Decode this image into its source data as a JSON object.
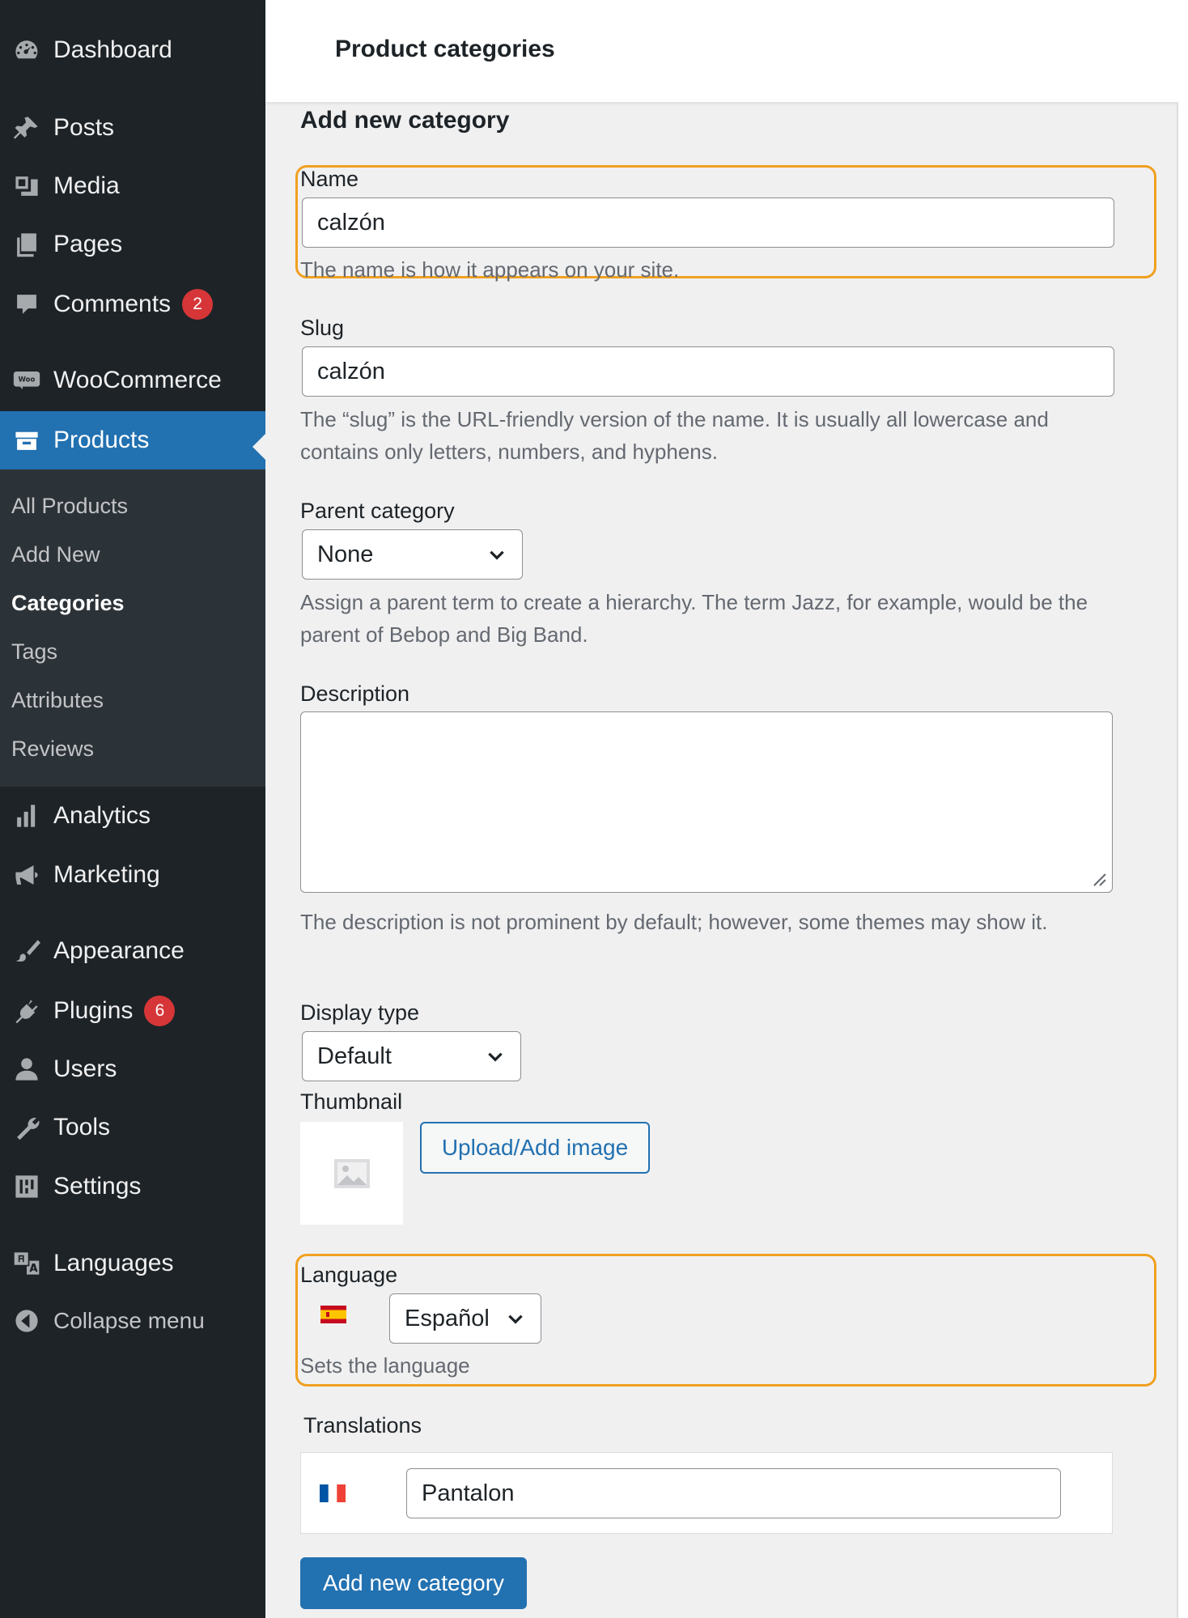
{
  "sidebar": {
    "menu": [
      {
        "id": "dashboard",
        "label": "Dashboard",
        "icon": "dashboard-icon"
      },
      {
        "id": "posts",
        "label": "Posts",
        "icon": "pin-icon"
      },
      {
        "id": "media",
        "label": "Media",
        "icon": "media-icon"
      },
      {
        "id": "pages",
        "label": "Pages",
        "icon": "pages-icon"
      },
      {
        "id": "comments",
        "label": "Comments",
        "icon": "comment-icon",
        "badge": "2"
      },
      {
        "id": "woocommerce",
        "label": "WooCommerce",
        "icon": "woo-icon"
      },
      {
        "id": "products",
        "label": "Products",
        "icon": "products-icon"
      },
      {
        "id": "analytics",
        "label": "Analytics",
        "icon": "bar-chart-icon"
      },
      {
        "id": "marketing",
        "label": "Marketing",
        "icon": "megaphone-icon"
      },
      {
        "id": "appearance",
        "label": "Appearance",
        "icon": "brush-icon"
      },
      {
        "id": "plugins",
        "label": "Plugins",
        "icon": "plug-icon",
        "badge": "6"
      },
      {
        "id": "users",
        "label": "Users",
        "icon": "user-icon"
      },
      {
        "id": "tools",
        "label": "Tools",
        "icon": "wrench-icon"
      },
      {
        "id": "settings",
        "label": "Settings",
        "icon": "sliders-icon"
      },
      {
        "id": "languages",
        "label": "Languages",
        "icon": "translate-icon"
      }
    ],
    "collapse_label": "Collapse menu",
    "submenu": [
      "All Products",
      "Add New",
      "Categories",
      "Tags",
      "Attributes",
      "Reviews"
    ],
    "current_submenu": "Categories"
  },
  "header": {
    "title": "Product categories"
  },
  "form": {
    "heading": "Add new category",
    "name": {
      "label": "Name",
      "value": "calzón",
      "help": "The name is how it appears on your site."
    },
    "slug": {
      "label": "Slug",
      "value": "calzón",
      "help": "The “slug” is the URL-friendly version of the name. It is usually all lowercase and contains only letters, numbers, and hyphens."
    },
    "parent": {
      "label": "Parent category",
      "value": "None",
      "help": "Assign a parent term to create a hierarchy. The term Jazz, for example, would be the parent of Bebop and Big Band."
    },
    "description": {
      "label": "Description",
      "value": "",
      "help": "The description is not prominent by default; however, some themes may show it."
    },
    "display_type": {
      "label": "Display type",
      "value": "Default"
    },
    "thumbnail": {
      "label": "Thumbnail",
      "button": "Upload/Add image"
    },
    "language": {
      "label": "Language",
      "value": "Español",
      "help": "Sets the language"
    },
    "translations": {
      "label": "Translations",
      "value": "Pantalon"
    },
    "submit_label": "Add new category"
  },
  "colors": {
    "sidebar_bg": "#1d2327",
    "submenu_bg": "#2c3338",
    "accent": "#2271b1",
    "badge": "#d63638",
    "highlight": "#f0a020"
  }
}
